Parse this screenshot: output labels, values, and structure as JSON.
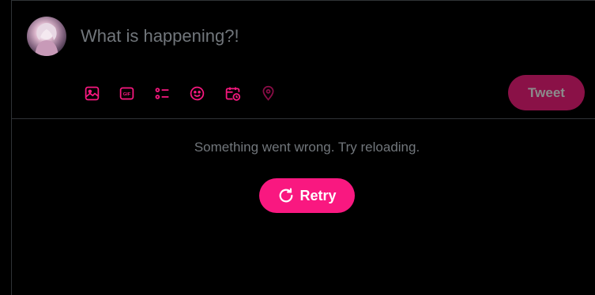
{
  "composer": {
    "placeholder": "What is happening?!",
    "avatar_icon": "user-avatar",
    "tweet_label": "Tweet"
  },
  "toolbar": {
    "items": [
      {
        "icon": "image-icon"
      },
      {
        "icon": "gif-icon",
        "text": "GIF"
      },
      {
        "icon": "poll-icon"
      },
      {
        "icon": "emoji-icon"
      },
      {
        "icon": "schedule-icon"
      },
      {
        "icon": "location-icon"
      }
    ]
  },
  "error": {
    "message": "Something went wrong. Try reloading.",
    "retry_label": "Retry",
    "retry_icon": "refresh-icon"
  },
  "colors": {
    "accent": "#f91880",
    "accent_disabled": "#8a1147",
    "background": "#000000",
    "muted_text": "#71767b",
    "border": "#2f3336"
  }
}
